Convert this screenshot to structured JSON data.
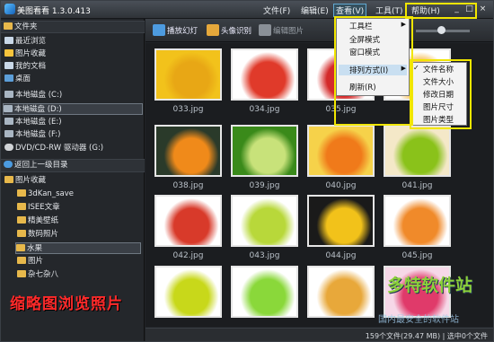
{
  "app": {
    "title": "美图看看 1.3.0.413"
  },
  "menubar": {
    "file": "文件(F)",
    "edit": "编辑(E)",
    "view": "查看(V)",
    "tools": "工具(T)",
    "help": "帮助(H)"
  },
  "window_controls": {
    "min": "_",
    "max": "□",
    "close": "×"
  },
  "sidebar": {
    "header": "文件夹",
    "items": [
      {
        "label": "最近浏览",
        "icon": "clock-icon"
      },
      {
        "label": "图片收藏",
        "icon": "star-icon"
      },
      {
        "label": "我的文档",
        "icon": "document-icon"
      },
      {
        "label": "桌面",
        "icon": "desktop-icon"
      },
      {
        "label": "本地磁盘 (C:)",
        "icon": "drive-icon"
      },
      {
        "label": "本地磁盘 (D:)",
        "icon": "drive-icon"
      },
      {
        "label": "本地磁盘 (E:)",
        "icon": "drive-icon"
      },
      {
        "label": "本地磁盘 (F:)",
        "icon": "drive-icon"
      },
      {
        "label": "DVD/CD-RW 驱动器 (G:)",
        "icon": "dvd-icon"
      }
    ],
    "up_button": "返回上一级目录",
    "tree": [
      {
        "label": "图片收藏"
      },
      {
        "label": "3dKan_save"
      },
      {
        "label": "ISEE文章"
      },
      {
        "label": "精美壁纸"
      },
      {
        "label": "数码照片"
      },
      {
        "label": "水果"
      },
      {
        "label": "图片"
      },
      {
        "label": "杂七杂八"
      }
    ]
  },
  "caption": "缩略图浏览照片",
  "toolbar": {
    "slideshow": "播放幻灯",
    "face_detect": "头像识别",
    "edit_image": "编辑图片"
  },
  "view_menu": {
    "items": [
      "工具栏",
      "全屏模式",
      "窗口模式",
      "排列方式(I)",
      "刷新(R)"
    ]
  },
  "sort_submenu": {
    "items": [
      "文件名称",
      "文件大小",
      "修改日期",
      "图片尺寸",
      "图片类型"
    ],
    "checked": "文件名称"
  },
  "thumbnails": [
    {
      "label": "033.jpg",
      "colors": [
        "#f2c21b",
        "#e8a715"
      ]
    },
    {
      "label": "034.jpg",
      "colors": [
        "#ffffff",
        "#e03a2a"
      ]
    },
    {
      "label": "035.jpg",
      "colors": [
        "#ffffff",
        "#d42a2a"
      ]
    },
    {
      "label": "",
      "colors": [
        "#ffffff",
        "#f4b43a"
      ]
    },
    {
      "label": "038.jpg",
      "colors": [
        "#2a3a2a",
        "#f08a1a"
      ]
    },
    {
      "label": "039.jpg",
      "colors": [
        "#3a8a1a",
        "#c8e27a"
      ]
    },
    {
      "label": "040.jpg",
      "colors": [
        "#f6d24a",
        "#f07a1a"
      ]
    },
    {
      "label": "041.jpg",
      "colors": [
        "#f4e8c8",
        "#8ac21a"
      ]
    },
    {
      "label": "042.jpg",
      "colors": [
        "#ffffff",
        "#d83a2a"
      ]
    },
    {
      "label": "043.jpg",
      "colors": [
        "#ffffff",
        "#b8d83a"
      ]
    },
    {
      "label": "044.jpg",
      "colors": [
        "#1a1a1a",
        "#f2c21a"
      ]
    },
    {
      "label": "045.jpg",
      "colors": [
        "#ffffff",
        "#f08a2a"
      ]
    },
    {
      "label": "",
      "colors": [
        "#ffffff",
        "#c8d81a"
      ]
    },
    {
      "label": "",
      "colors": [
        "#ffffff",
        "#8ad83a"
      ]
    },
    {
      "label": "",
      "colors": [
        "#ffffff",
        "#e8a83a"
      ]
    },
    {
      "label": "",
      "colors": [
        "#f6d8e8",
        "#e03a6a"
      ]
    }
  ],
  "status": {
    "text": "159个文件(29.47 MB) | 选中0个文件"
  },
  "watermark": {
    "logo": "多特软件站",
    "sub": "国内最安全的软件站"
  }
}
